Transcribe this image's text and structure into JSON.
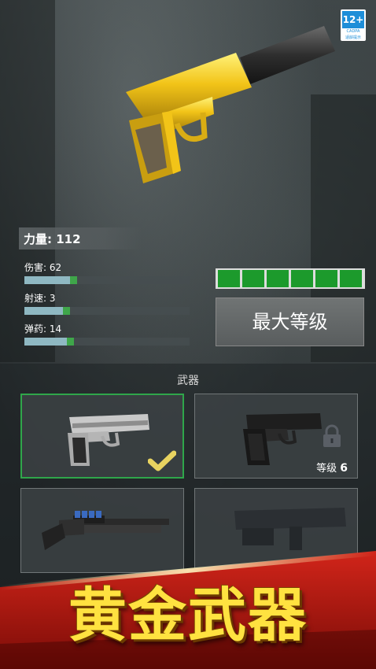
{
  "age_badge": {
    "rating": "12+",
    "line1": "CADPA",
    "line2": "适龄提示"
  },
  "power": {
    "label": "力量: 112"
  },
  "stats": [
    {
      "label": "伤害: 62",
      "value": 62
    },
    {
      "label": "射速: 3",
      "value": 3
    },
    {
      "label": "弹药: 14",
      "value": 14
    }
  ],
  "level_segments_filled": 6,
  "max_level_button": "最大等级",
  "section_title": "武器",
  "weapons": [
    {
      "name": "silver-pistol",
      "selected": true,
      "locked": false
    },
    {
      "name": "black-pistol",
      "selected": false,
      "locked": true,
      "lock_text": "等级",
      "lock_level": "6"
    },
    {
      "name": "shotgun",
      "selected": false,
      "locked": false
    },
    {
      "name": "smg",
      "selected": false,
      "locked": false
    }
  ],
  "banner_text": "黄金武器",
  "colors": {
    "gold": "#f2c418",
    "green": "#1c9a2c",
    "banner": "#ffe240",
    "stat_fill": "#8fb8c2"
  }
}
